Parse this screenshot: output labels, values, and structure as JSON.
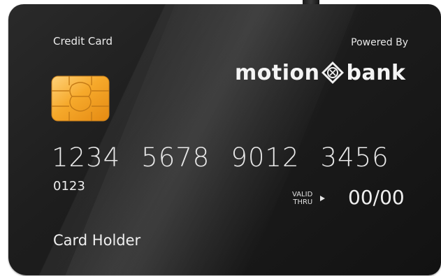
{
  "card": {
    "type_label": "Credit Card",
    "powered_by": "Powered By",
    "brand": {
      "left": "motion",
      "right": "bank"
    },
    "number_groups": [
      "1234",
      "5678",
      "9012",
      "3456"
    ],
    "short_number": "0123",
    "valid_thru": {
      "line1": "VALID",
      "line2": "THRU"
    },
    "expiry": "00/00",
    "holder": "Card Holder"
  },
  "colors": {
    "card_background": "#1c1c1c",
    "text": "#ececec",
    "chip_gold": "#f0a830"
  },
  "icons": {
    "chip": "emv-chip-icon",
    "logo_mark": "diamond-logo-icon",
    "arrow": "triangle-right-icon"
  }
}
